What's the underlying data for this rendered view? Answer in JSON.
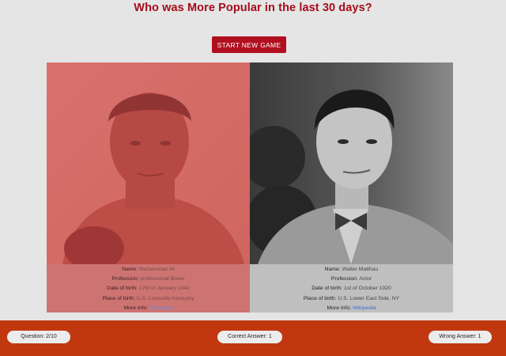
{
  "header": {
    "title": "Who was More Popular in the last 30 days?",
    "new_game_label": "START NEW GAME"
  },
  "labels": {
    "name": "Name:",
    "profession": "Profession:",
    "dob": "Date of birth:",
    "pob": "Place of birth:",
    "more": "More Info:"
  },
  "left": {
    "name": "Muhammad Ali",
    "profession": "professional Boxer",
    "dob": "17th of January 1942",
    "pob": "U.S. Louisville Kentucky",
    "link": "Wikipedia"
  },
  "right": {
    "name": "Walter Matthau",
    "profession": "Actor",
    "dob": "1st of October 1920",
    "pob": "U.S. Lower East Side, NY",
    "link": "Wikipedia"
  },
  "footer": {
    "question": "Question: 2/10",
    "correct": "Correct Answer: 1",
    "wrong": "Wrong Answer: 1"
  },
  "colors": {
    "accent": "#b10f1f",
    "footer": "#c13810",
    "left_highlight": "#e65050"
  }
}
